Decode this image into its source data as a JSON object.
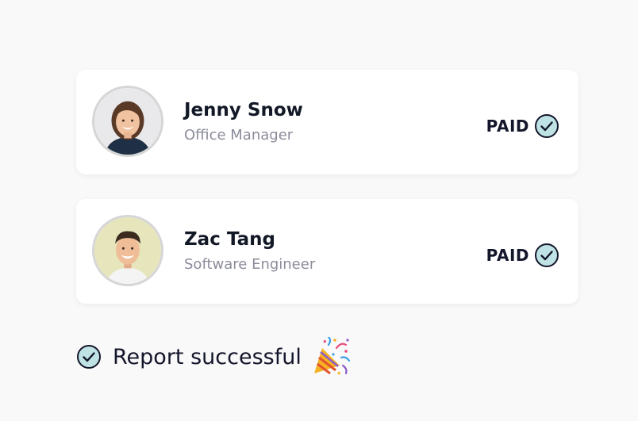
{
  "payments": [
    {
      "name": "Jenny Snow",
      "role": "Office Manager",
      "status": "PAID",
      "avatar": "woman-portrait"
    },
    {
      "name": "Zac Tang",
      "role": "Software Engineer",
      "status": "PAID",
      "avatar": "man-portrait"
    }
  ],
  "report": {
    "message": "Report successful",
    "icon": "party-popper-icon"
  },
  "colors": {
    "check_fill": "#bfe3e4",
    "check_stroke": "#14162b",
    "text_primary": "#14162b",
    "text_secondary": "#8b8c9b",
    "background": "#f9f9f9",
    "card": "#ffffff"
  }
}
